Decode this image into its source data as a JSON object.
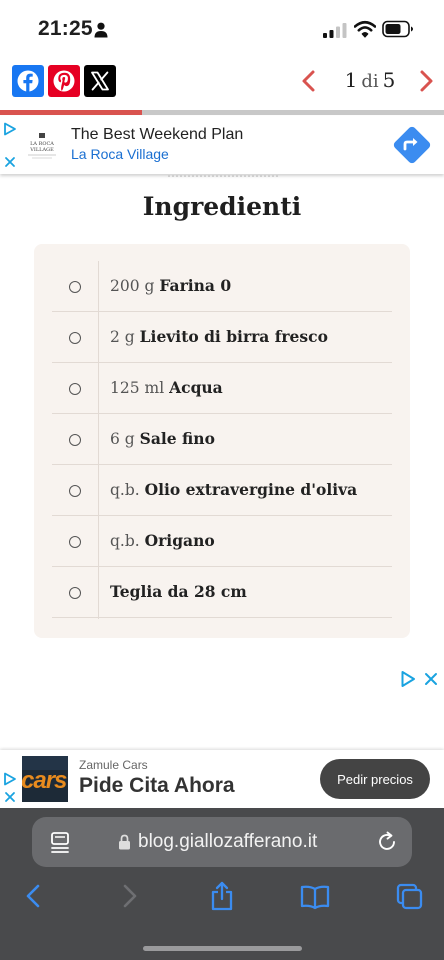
{
  "status_bar": {
    "time": "21:25"
  },
  "share": {
    "pager_current": "1",
    "pager_of": "di",
    "pager_total": "5",
    "progress": 0.32
  },
  "ad_top": {
    "logo_text": "LA ROCA VILLAGE",
    "title": "The Best Weekend Plan",
    "subtitle": "La Roca Village"
  },
  "heading": "Ingredienti",
  "ingredients": [
    {
      "qty": "200 g",
      "name": "Farina 0"
    },
    {
      "qty": "2 g",
      "name": "Lievito di birra fresco"
    },
    {
      "qty": "125 ml",
      "name": "Acqua"
    },
    {
      "qty": "6 g",
      "name": "Sale fino"
    },
    {
      "qty": "q.b.",
      "name": "Olio extravergine d'oliva"
    },
    {
      "qty": "q.b.",
      "name": "Origano"
    },
    {
      "qty": "",
      "name": "Teglia da 28 cm"
    }
  ],
  "ad_bottom": {
    "brand": "Zamule Cars",
    "title": "Pide Cita Ahora",
    "button": "Pedir precios",
    "thumb_text": "cars"
  },
  "browser": {
    "url": "blog.giallozafferano.it"
  },
  "colors": {
    "facebook": "#1877f2",
    "pinterest": "#e60023",
    "x": "#000000",
    "accent_red": "#d9534f",
    "card_bg": "#f8f3ef",
    "safari_blue": "#3b8cf0"
  }
}
